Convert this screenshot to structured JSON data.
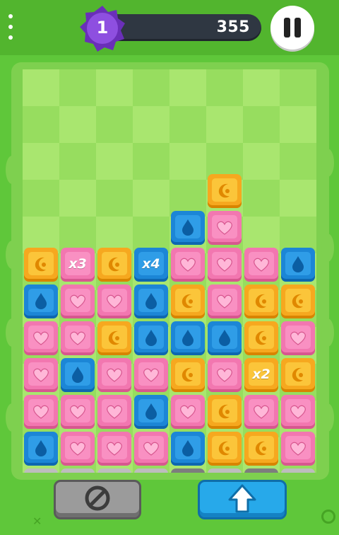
{
  "level": "1",
  "score": "355",
  "colors": {
    "yellow": "#f6a81f",
    "pink": "#f277b0",
    "blue": "#1c86d6",
    "gray": "#bdbdbd",
    "badge": "#7a3cc9"
  },
  "icons": {
    "yellow": "moon-icon",
    "pink": "heart-icon",
    "blue": "drop-icon"
  },
  "grid": {
    "columns": 8,
    "rows": [
      [
        "",
        "",
        "",
        "",
        "",
        "yellow",
        "",
        ""
      ],
      [
        "",
        "",
        "",
        "",
        "blue",
        "pink",
        "",
        ""
      ],
      [
        "yellow",
        "pink:x3",
        "yellow",
        "blue:x4",
        "pink",
        "pink",
        "pink",
        "blue"
      ],
      [
        "blue",
        "pink",
        "pink",
        "blue",
        "yellow",
        "pink",
        "yellow",
        "yellow"
      ],
      [
        "pink",
        "pink",
        "yellow",
        "blue",
        "blue",
        "blue",
        "yellow",
        "pink"
      ],
      [
        "pink",
        "blue",
        "pink",
        "pink",
        "yellow",
        "pink",
        "yellow:x2",
        "yellow"
      ],
      [
        "pink",
        "pink",
        "pink",
        "blue",
        "pink",
        "yellow",
        "pink",
        "pink"
      ],
      [
        "blue",
        "pink",
        "pink",
        "pink",
        "blue",
        "yellow",
        "yellow",
        "pink"
      ],
      [
        "gray",
        "gray",
        "gray",
        "gray",
        "dgray",
        "gray",
        "dgray",
        "gray"
      ]
    ]
  },
  "buttons": {
    "cancel_icon": "block-icon",
    "push_icon": "arrow-up-icon"
  }
}
